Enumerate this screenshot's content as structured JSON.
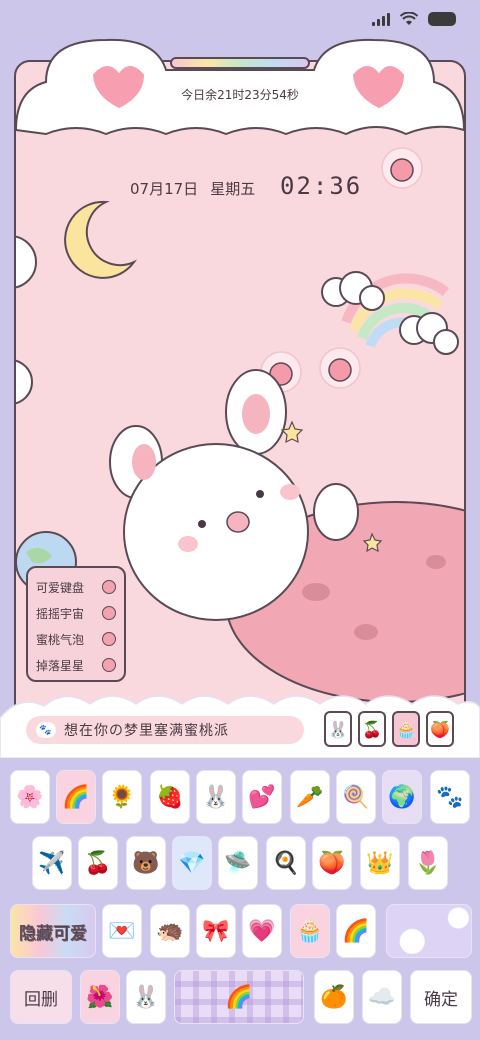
{
  "status": {
    "signal_bars": 4
  },
  "countdown": "今日余21时23分54秒",
  "date": {
    "day": "07月17日",
    "weekday": "星期五"
  },
  "clock": "02:36",
  "widget_list": {
    "items": [
      {
        "label": "可爱键盘"
      },
      {
        "label": "摇摇宇宙"
      },
      {
        "label": "蜜桃气泡"
      },
      {
        "label": "掉落星星"
      }
    ]
  },
  "search": {
    "text": "想在你の梦里塞满蜜桃派"
  },
  "mini_icons": [
    {
      "icon": "🐰"
    },
    {
      "icon": "🍒"
    },
    {
      "icon": "🧁"
    },
    {
      "icon": "🍑"
    }
  ],
  "tiles": {
    "row1": [
      "🌸",
      "🌈",
      "🌻",
      "🍓",
      "🐰",
      "💕",
      "🥕",
      "🍭",
      "🌍",
      "🐾"
    ],
    "row2": [
      "✈️",
      "🍒",
      "🐻",
      "💎",
      "🛸",
      "🍳",
      "🍑",
      "👑",
      "🌷"
    ],
    "row3_text": "隐藏可爱",
    "row3": [
      "💌",
      "🦔",
      "🎀",
      "💗",
      "🧁",
      "🌈"
    ],
    "row4_left": "回删",
    "row4": [
      "🌺",
      "🐰",
      "🌈",
      "🍊",
      "☁️"
    ],
    "row4_right": "确定"
  },
  "colors": {
    "background": "#ccc6ea",
    "frame": "#f9d9dd",
    "accent": "#f4a2b0"
  }
}
